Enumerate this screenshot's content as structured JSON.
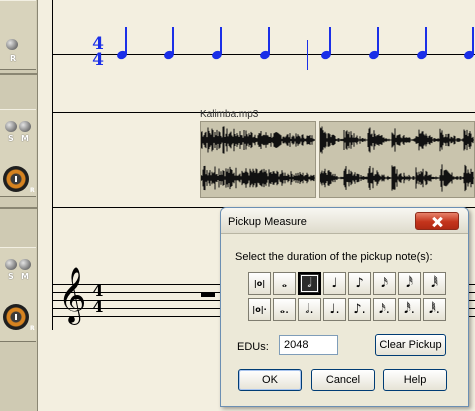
{
  "tracks": {
    "record_label": "R",
    "solo_label": "S",
    "mute_label": "M",
    "knob_label": "R"
  },
  "score": {
    "time_signature_top": "4",
    "time_signature_bottom": "4",
    "audio_clip_title": "Kalimba.mp3",
    "treble_clef_glyph": "𝄞",
    "note_color": "#1a2fe8"
  },
  "dialog": {
    "title": "Pickup Measure",
    "prompt": "Select the duration of the pickup note(s):",
    "row1_buttons": [
      {
        "name": "double-whole-note-button",
        "glyph": "|o|"
      },
      {
        "name": "whole-note-button",
        "glyph": "𝅝"
      },
      {
        "name": "half-note-button",
        "glyph": "𝅗𝅥"
      },
      {
        "name": "quarter-note-button",
        "glyph": "♩"
      },
      {
        "name": "eighth-note-button",
        "glyph": "♪"
      },
      {
        "name": "sixteenth-note-button",
        "glyph": "𝅘𝅥𝅯"
      },
      {
        "name": "thirty-second-note-button",
        "glyph": "𝅘𝅥𝅰"
      },
      {
        "name": "sixty-fourth-note-button",
        "glyph": "𝅘𝅥𝅱"
      }
    ],
    "row2_buttons": [
      {
        "name": "dotted-double-whole-note-button",
        "glyph": "|o|·"
      },
      {
        "name": "dotted-whole-note-button",
        "glyph": "𝅝."
      },
      {
        "name": "dotted-half-note-button",
        "glyph": "𝅗𝅥."
      },
      {
        "name": "dotted-quarter-note-button",
        "glyph": "♩."
      },
      {
        "name": "dotted-eighth-note-button",
        "glyph": "♪."
      },
      {
        "name": "dotted-sixteenth-note-button",
        "glyph": "𝅘𝅥𝅯."
      },
      {
        "name": "dotted-thirty-second-note-button",
        "glyph": "𝅘𝅥𝅰."
      },
      {
        "name": "dotted-sixty-fourth-note-button",
        "glyph": "𝅘𝅥𝅱."
      }
    ],
    "selected_duration": "half-note",
    "edus_label": "EDUs:",
    "edus_value": "2048",
    "clear_pickup_label": "Clear Pickup",
    "ok_label": "OK",
    "cancel_label": "Cancel",
    "help_label": "Help"
  }
}
